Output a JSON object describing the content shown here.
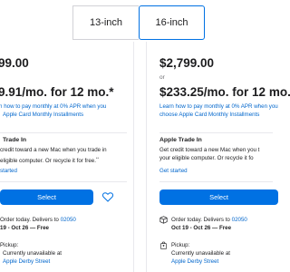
{
  "tabs": [
    {
      "label": "13-inch",
      "selected": false
    },
    {
      "label": "16-inch",
      "selected": true
    }
  ],
  "left": {
    "price": "99.00",
    "monthly": "9.91/mo. for 12 mo.*",
    "apr_line1": "rn how to pay monthly at 0% APR when you",
    "apr_line2": "Apple Card Monthly Installments",
    "trade_heading": "Trade In",
    "trade_line1": "credit toward a new Mac when you trade in",
    "trade_line2": "eligible computer. Or recycle it for free.",
    "trade_sup": "**",
    "get_started": "started",
    "select": "Select",
    "order_prefix": "Order today. Delivers to",
    "zip": "02050",
    "delivery": "19 - Oct 26 — Free",
    "pickup_label": "Pickup:",
    "pickup_status": "Currently unavailable at",
    "store": "Apple Derby Street"
  },
  "right": {
    "price": "$2,799.00",
    "or": "or",
    "monthly": "$233.25/mo. for 12 mo.",
    "apr_line1": "Learn how to pay monthly at 0% APR when you",
    "apr_line2": "choose Apple Card Monthly Installments",
    "trade_heading": "Apple Trade In",
    "trade_line1": "Get credit toward a new Mac when you t",
    "trade_line2": "your eligible computer. Or recycle it fo",
    "get_started": "Get started",
    "select": "Select",
    "order_prefix": "Order today. Delivers to",
    "zip": "02050",
    "delivery": "Oct 19 - Oct 26 — Free",
    "pickup_label": "Pickup:",
    "pickup_status": "Currently unavailable at",
    "store": "Apple Derby Street"
  },
  "colors": {
    "accent": "#0071e3",
    "link": "#0066cc",
    "text": "#1d1d1f",
    "muted": "#6e6e73"
  }
}
